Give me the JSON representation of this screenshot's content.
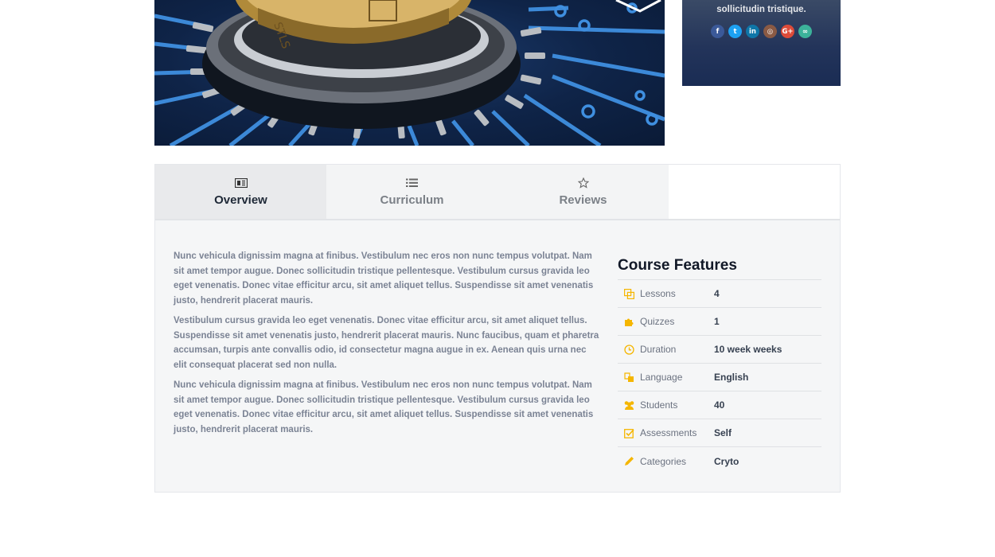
{
  "author": {
    "bio_tail": "sollicitudin tristique.",
    "socials": [
      {
        "name": "facebook",
        "glyph": "f",
        "color": "#3b5998"
      },
      {
        "name": "twitter",
        "glyph": "t",
        "color": "#1da1f2"
      },
      {
        "name": "linkedin",
        "glyph": "in",
        "color": "#0e76a8"
      },
      {
        "name": "instagram",
        "glyph": "◎",
        "color": "#8a5a44"
      },
      {
        "name": "google-plus",
        "glyph": "G+",
        "color": "#dd4b39"
      },
      {
        "name": "link",
        "glyph": "∞",
        "color": "#3cb29a"
      }
    ]
  },
  "tabs": [
    {
      "label": "Overview",
      "icon": "overview-icon",
      "active": true
    },
    {
      "label": "Curriculum",
      "icon": "list-icon",
      "active": false
    },
    {
      "label": "Reviews",
      "icon": "star-icon",
      "active": false
    }
  ],
  "overview": {
    "paragraphs": [
      "Nunc vehicula dignissim magna at finibus. Vestibulum nec eros non nunc tempus volutpat. Nam sit amet tempor augue. Donec sollicitudin tristique pellentesque. Vestibulum cursus gravida leo eget venenatis. Donec vitae efficitur arcu, sit amet aliquet tellus. Suspendisse sit amet venenatis justo, hendrerit placerat mauris.",
      "Vestibulum cursus gravida leo eget venenatis. Donec vitae efficitur arcu, sit amet aliquet tellus. Suspendisse sit amet venenatis justo, hendrerit placerat mauris. Nunc faucibus, quam et pharetra accumsan, turpis ante convallis odio, id consectetur magna augue in ex. Aenean quis urna nec elit consequat placerat sed non nulla.",
      "Nunc vehicula dignissim magna at finibus. Vestibulum nec eros non nunc tempus volutpat. Nam sit amet tempor augue. Donec sollicitudin tristique pellentesque. Vestibulum cursus gravida leo eget venenatis. Donec vitae efficitur arcu, sit amet aliquet tellus. Suspendisse sit amet venenatis justo, hendrerit placerat mauris."
    ]
  },
  "features": {
    "title": "Course Features",
    "items": [
      {
        "icon": "lessons-icon",
        "label": "Lessons",
        "value": "4"
      },
      {
        "icon": "puzzle-icon",
        "label": "Quizzes",
        "value": "1"
      },
      {
        "icon": "clock-icon",
        "label": "Duration",
        "value": "10 week weeks"
      },
      {
        "icon": "language-icon",
        "label": "Language",
        "value": "English"
      },
      {
        "icon": "users-icon",
        "label": "Students",
        "value": "40"
      },
      {
        "icon": "check-square-icon",
        "label": "Assessments",
        "value": "Self"
      },
      {
        "icon": "pencil-icon",
        "label": "Categories",
        "value": "Cryto"
      }
    ]
  },
  "colors": {
    "accent": "#f5b600",
    "active_tab_text": "#1f2937"
  }
}
